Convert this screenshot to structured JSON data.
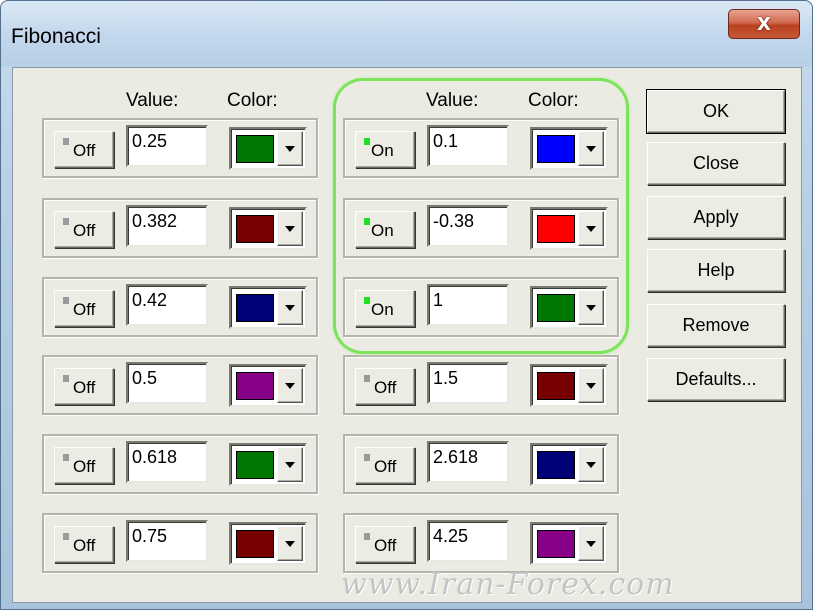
{
  "window": {
    "title": "Fibonacci",
    "close_glyph": "X"
  },
  "headers": {
    "value": "Value:",
    "color": "Color:"
  },
  "levels_left": [
    {
      "state": "Off",
      "on": false,
      "value": "0.25",
      "color": "#007700"
    },
    {
      "state": "Off",
      "on": false,
      "value": "0.382",
      "color": "#770000"
    },
    {
      "state": "Off",
      "on": false,
      "value": "0.42",
      "color": "#000077"
    },
    {
      "state": "Off",
      "on": false,
      "value": "0.5",
      "color": "#880088"
    },
    {
      "state": "Off",
      "on": false,
      "value": "0.618",
      "color": "#007700"
    },
    {
      "state": "Off",
      "on": false,
      "value": "0.75",
      "color": "#770000"
    }
  ],
  "levels_right": [
    {
      "state": "On",
      "on": true,
      "value": "0.1",
      "color": "#0000ff"
    },
    {
      "state": "On",
      "on": true,
      "value": "-0.38",
      "color": "#ff0000"
    },
    {
      "state": "On",
      "on": true,
      "value": "1",
      "color": "#007700"
    },
    {
      "state": "Off",
      "on": false,
      "value": "1.5",
      "color": "#770000"
    },
    {
      "state": "Off",
      "on": false,
      "value": "2.618",
      "color": "#000077"
    },
    {
      "state": "Off",
      "on": false,
      "value": "4.25",
      "color": "#880088"
    }
  ],
  "buttons": {
    "ok": "OK",
    "close": "Close",
    "apply": "Apply",
    "help": "Help",
    "remove": "Remove",
    "defaults": "Defaults..."
  },
  "watermark": "www.Iran-Forex.com",
  "colors": {
    "highlight": "#7ce35a",
    "led_on": "#22dd22",
    "led_off": "#9a9a9a"
  }
}
